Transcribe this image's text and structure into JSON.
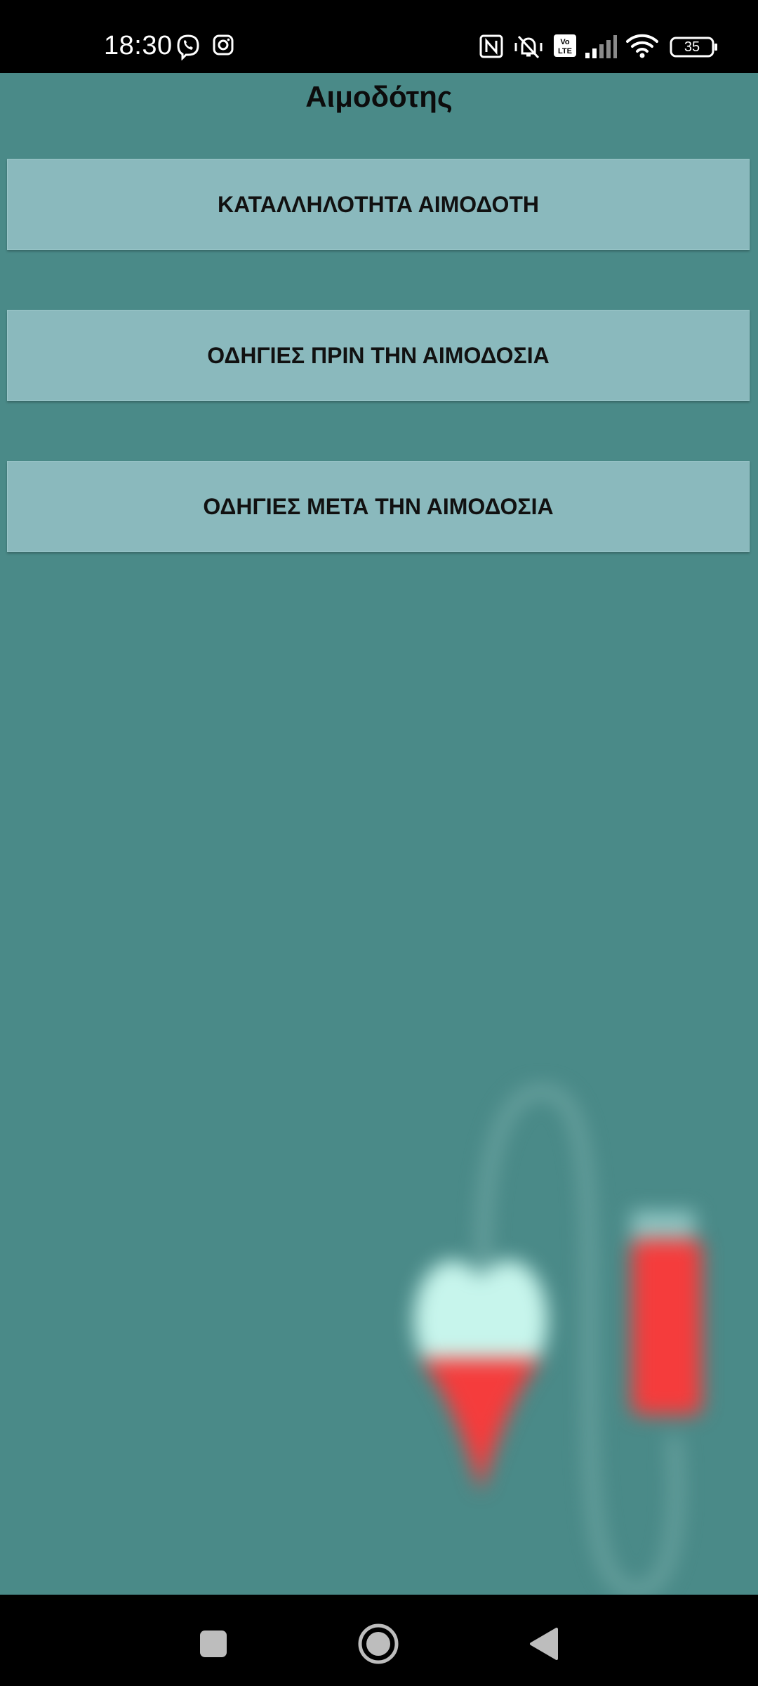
{
  "status_bar": {
    "time": "18:30",
    "battery": "35",
    "left_icons": [
      "viber-icon",
      "instagram-icon"
    ],
    "right_icons": [
      "nfc-icon",
      "vibrate-mute-icon",
      "volte-icon",
      "signal-icon",
      "wifi-icon",
      "battery-icon"
    ]
  },
  "app": {
    "title": "Αιμοδότης",
    "background_color": "#4a8a88",
    "button_color": "#8ab9bd",
    "buttons": [
      {
        "label": "ΚΑΤΑΛΛΗΛΟΤΗΤΑ ΑΙΜΟΔΟΤΗ"
      },
      {
        "label": "ΟΔΗΓΙΕΣ ΠΡΙΝ ΤΗΝ ΑΙΜΟΔΟΣΙΑ"
      },
      {
        "label": "ΟΔΗΓΙΕΣ ΜΕΤΑ ΤΗΝ ΑΙΜΟΔΟΣΙΑ"
      }
    ],
    "background_illustration": "blood-donation-heart-bag-icon"
  },
  "nav_bar": {
    "buttons": [
      "recents-icon",
      "home-icon",
      "back-icon"
    ]
  }
}
